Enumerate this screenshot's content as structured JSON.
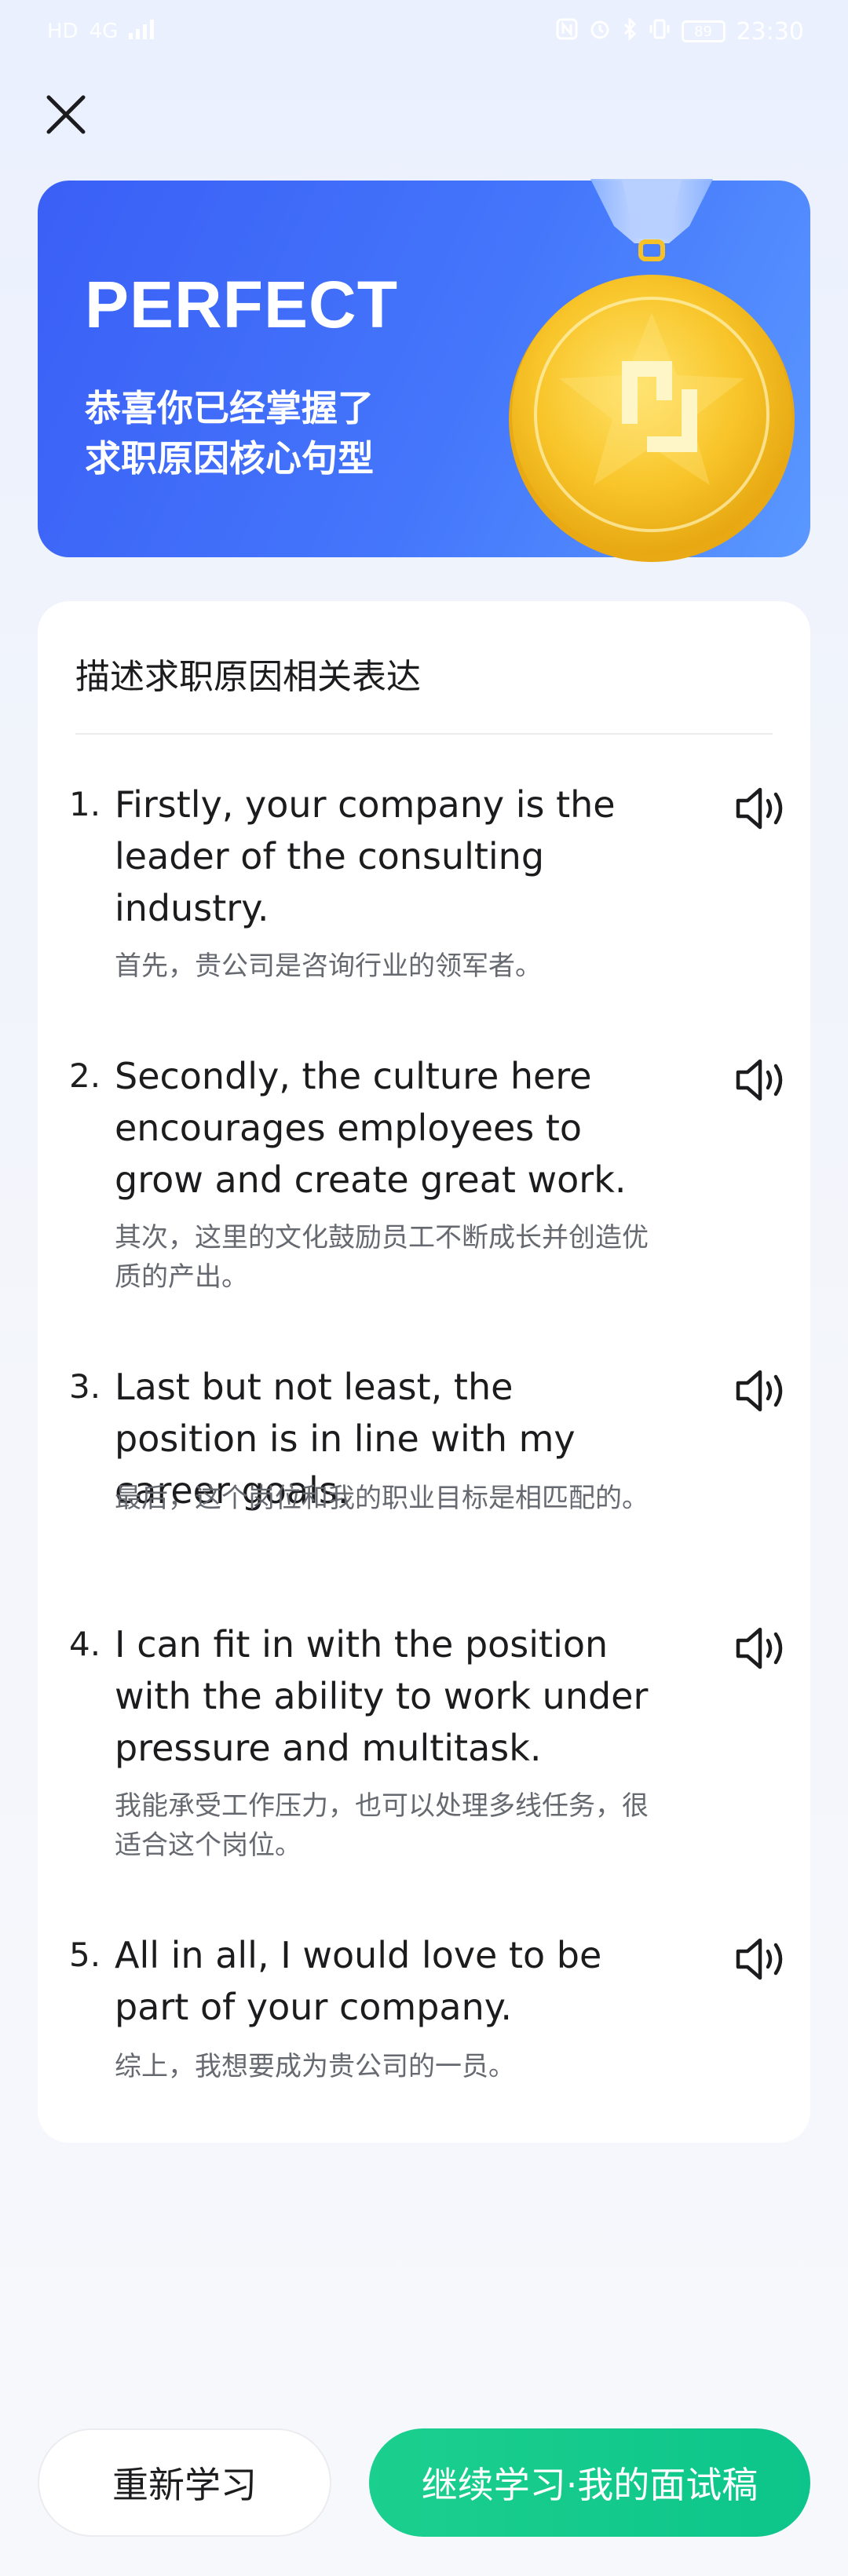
{
  "status_bar": {
    "left_glyphs": [
      "HD",
      "4G",
      "signal"
    ],
    "right_glyphs": [
      "NFC",
      "alarm",
      "bluetooth",
      "vibrate"
    ],
    "battery": "89",
    "time": "23:30"
  },
  "hero": {
    "title": "PERFECT",
    "subtitle_line1": "恭喜你已经掌握了",
    "subtitle_line2": "求职原因核心句型"
  },
  "card": {
    "title": "描述求职原因相关表达",
    "sentences": [
      {
        "num": "1.",
        "en": "Firstly, your company is the leader of the consulting industry.",
        "cn": "首先，贵公司是咨询行业的领军者。"
      },
      {
        "num": "2.",
        "en": "Secondly, the culture here encourages employees to grow and create great work.",
        "cn": "其次，这里的文化鼓励员工不断成长并创造优质的产出。"
      },
      {
        "num": "3.",
        "en": "Last but not least, the position is in line with my career goals.",
        "cn": " 最后，这个岗位和我的职业目标是相匹配的。"
      },
      {
        "num": "4.",
        "en": "I can fit in with the position with the ability to work under pressure and multitask.",
        "cn": "我能承受工作压力，也可以处理多线任务，很适合这个岗位。"
      },
      {
        "num": "5.",
        "en": "All in all, I would love to be part of your company.",
        "cn": "综上，我想要成为贵公司的一员。"
      }
    ]
  },
  "buttons": {
    "restart": "重新学习",
    "continue": "继续学习·我的面试稿"
  },
  "colors": {
    "hero_blue": "#3a5ff6",
    "green": "#10c98b",
    "medal_gold": "#f7c325"
  }
}
